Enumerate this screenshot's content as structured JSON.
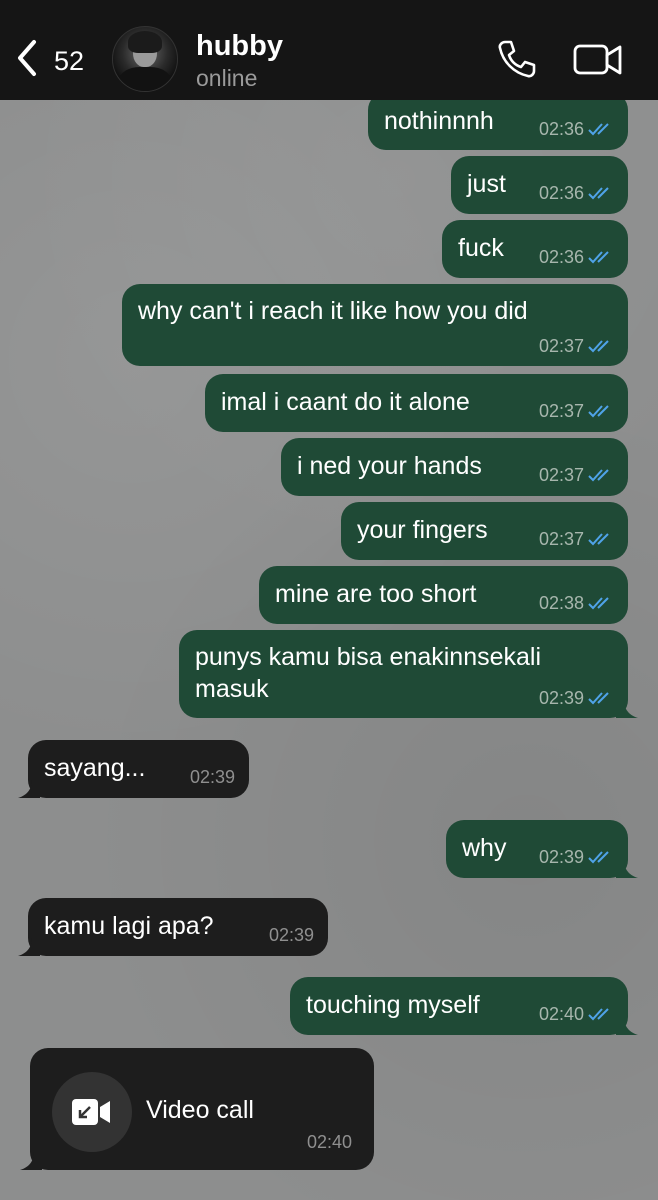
{
  "header": {
    "unread_count": "52",
    "contact_name": "hubby",
    "contact_status": "online",
    "icons": [
      "back-chevron-icon",
      "phone-icon",
      "video-camera-icon"
    ]
  },
  "messages": [
    {
      "dir": "out",
      "text": "nothinnnh",
      "time": "02:36",
      "read": true
    },
    {
      "dir": "out",
      "text": "just",
      "time": "02:36",
      "read": true
    },
    {
      "dir": "out",
      "text": "fuck",
      "time": "02:36",
      "read": true
    },
    {
      "dir": "out",
      "text": "why can't i reach it like how you did",
      "time": "02:37",
      "read": true
    },
    {
      "dir": "out",
      "text": "imal i caant do it alone",
      "time": "02:37",
      "read": true
    },
    {
      "dir": "out",
      "text": "i ned your hands",
      "time": "02:37",
      "read": true
    },
    {
      "dir": "out",
      "text": "your fingers",
      "time": "02:37",
      "read": true
    },
    {
      "dir": "out",
      "text": "mine are too short",
      "time": "02:38",
      "read": true
    },
    {
      "dir": "out",
      "text_lines": [
        "punys kamu bisa enakinnsekali",
        "masuk"
      ],
      "time": "02:39",
      "read": true
    },
    {
      "dir": "in",
      "text": "sayang...",
      "time": "02:39"
    },
    {
      "dir": "out",
      "text": "why",
      "time": "02:39",
      "read": true
    },
    {
      "dir": "in",
      "text": "kamu lagi apa?",
      "time": "02:39"
    },
    {
      "dir": "out",
      "text": "touching myself",
      "time": "02:40",
      "read": true
    }
  ],
  "video_call": {
    "label": "Video call",
    "time": "02:40"
  },
  "colors": {
    "header_bg": "#151515",
    "outgoing_bubble": "#1f4a36",
    "incoming_bubble": "#1d1d1d",
    "read_ticks": "#4fa3e8",
    "background": "#8d8e8e"
  }
}
